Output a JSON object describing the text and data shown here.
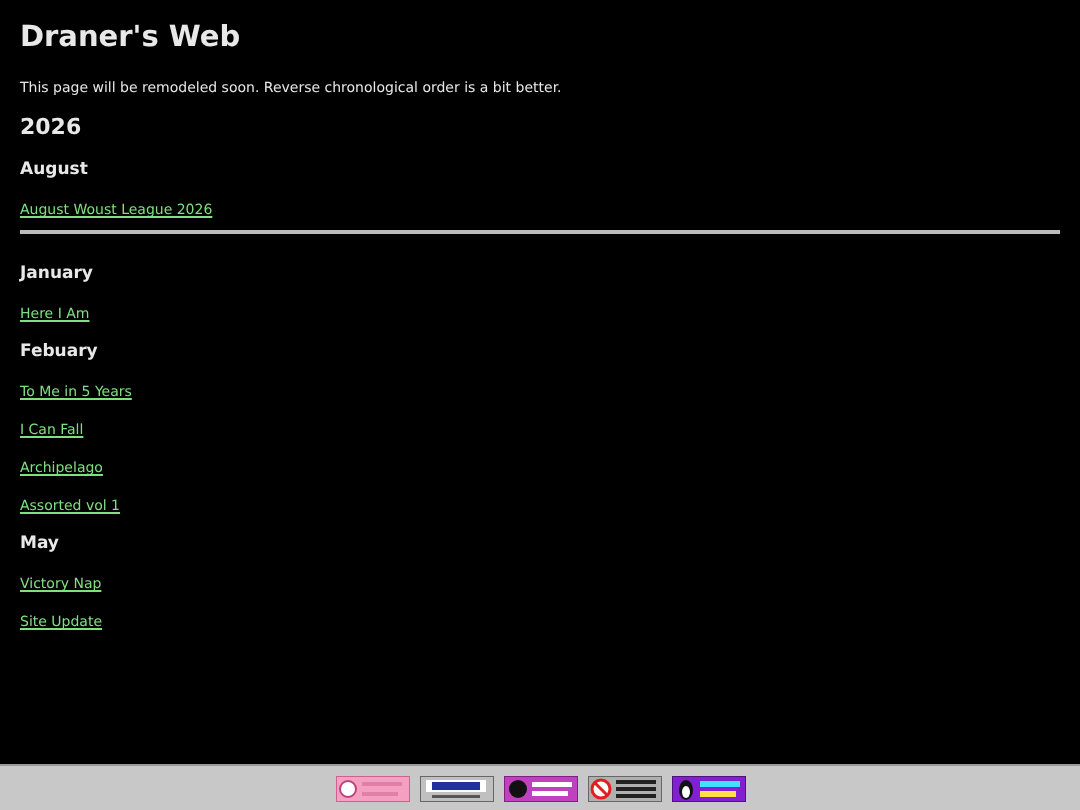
{
  "title": "Draner's Web",
  "intro": "This page will be remodeled soon. Reverse chronological order is a bit better.",
  "sections": [
    {
      "year": "2026",
      "months": [
        {
          "name": "August",
          "links": [
            "August Woust League 2026"
          ]
        }
      ]
    },
    {
      "months": [
        {
          "name": "January",
          "links": [
            "Here I Am"
          ]
        },
        {
          "name": "Febuary",
          "links": [
            "To Me in 5 Years",
            "I Can Fall",
            "Archipelago",
            "Assorted vol 1"
          ]
        },
        {
          "name": "May",
          "links": [
            "Victory Nap",
            "Site Update"
          ]
        }
      ]
    }
  ],
  "footer_badges": [
    {
      "kind": "flower"
    },
    {
      "kind": "html"
    },
    {
      "kind": "github"
    },
    {
      "kind": "nocookie"
    },
    {
      "kind": "linux"
    }
  ]
}
